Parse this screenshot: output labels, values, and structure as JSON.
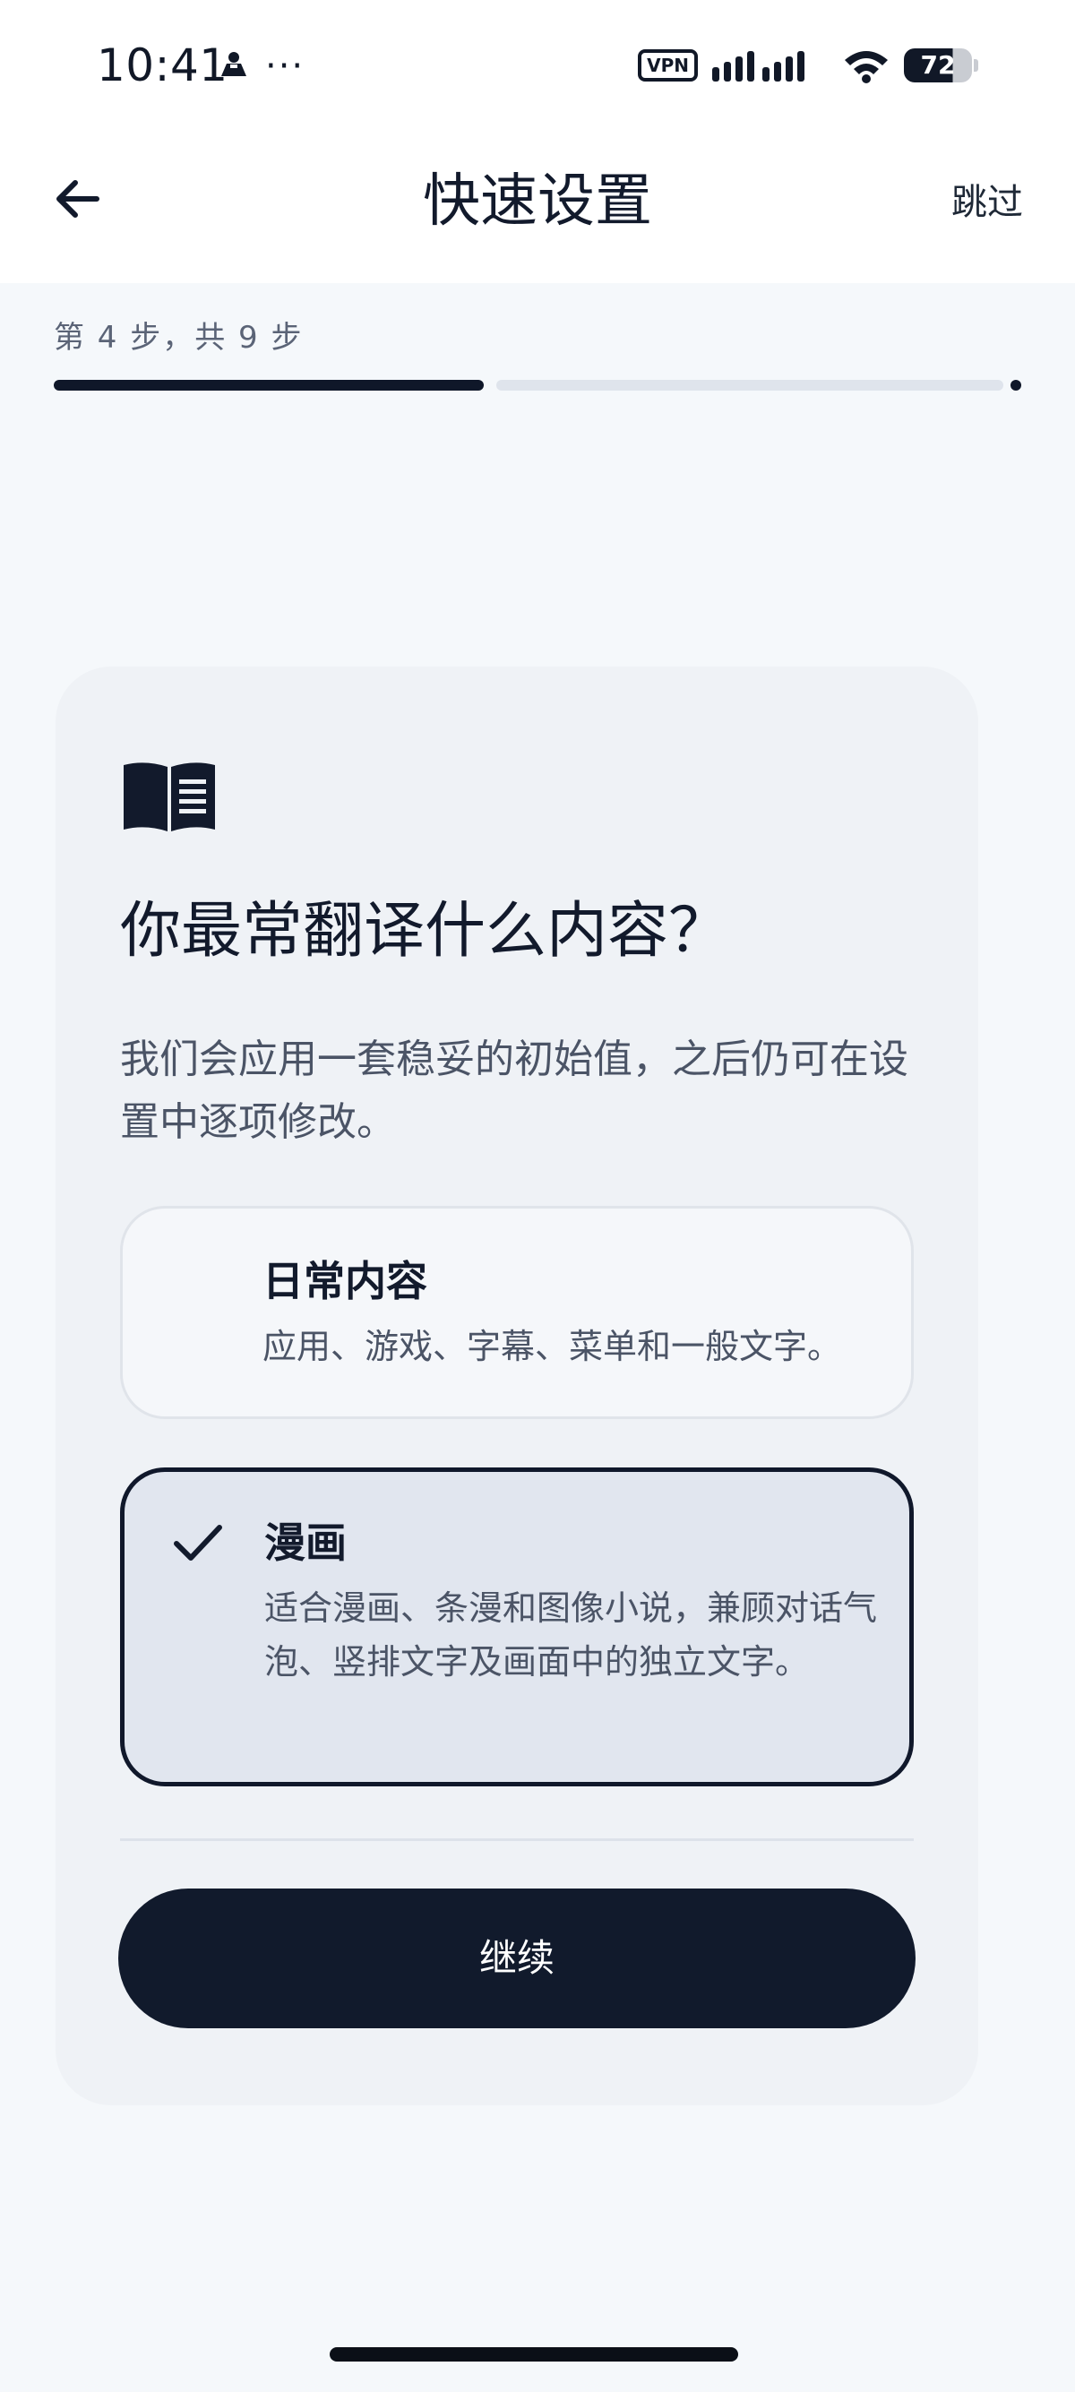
{
  "status_bar": {
    "time": "10:41",
    "dots": "···",
    "vpn": "VPN",
    "battery": "72"
  },
  "header": {
    "title": "快速设置",
    "skip": "跳过"
  },
  "progress": {
    "step_text": "第 4 步，共 9 步",
    "current_step": 4,
    "total_steps": 9
  },
  "card": {
    "question": "你最常翻译什么内容？",
    "intro": "我们会应用一套稳妥的初始值，之后仍可在设置中逐项修改。",
    "options": [
      {
        "title": "日常内容",
        "description": "应用、游戏、字幕、菜单和一般文字。",
        "selected": false
      },
      {
        "title": "漫画",
        "description": "适合漫画、条漫和图像小说，兼顾对话气泡、竖排文字及画面中的独立文字。",
        "selected": true
      }
    ],
    "continue": "继续"
  }
}
